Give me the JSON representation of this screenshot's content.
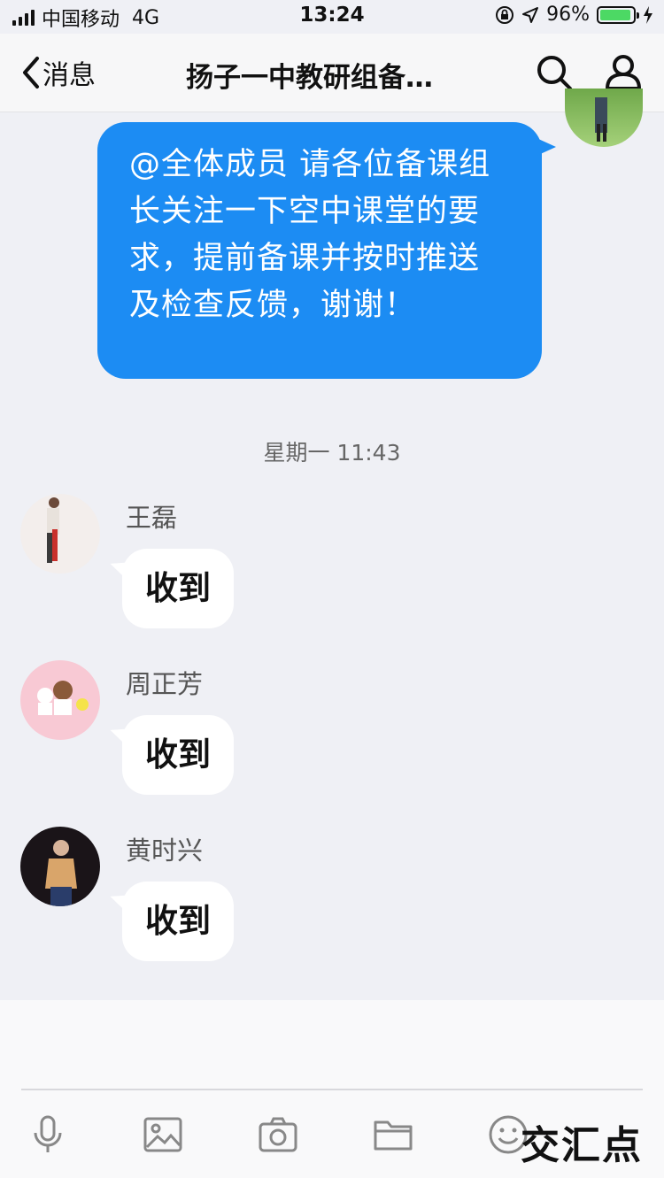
{
  "status": {
    "carrier": "中国移动",
    "network": "4G",
    "time": "13:24",
    "battery": "96%",
    "battery_level": 0.96
  },
  "nav": {
    "back_label": "消息",
    "title": "扬子一中教研组备…"
  },
  "outgoing_message": {
    "text": "@全体成员 请各位备课组长关注一下空中课堂的要求，提前备课并按时推送及检查反馈，谢谢！"
  },
  "timestamp": "星期一 11:43",
  "messages": [
    {
      "sender": "王磊",
      "text": "收到"
    },
    {
      "sender": "周正芳",
      "text": "收到"
    },
    {
      "sender": "黄时兴",
      "text": "收到"
    }
  ],
  "toolbar": {
    "icons": [
      "microphone-icon",
      "image-icon",
      "camera-icon",
      "folder-icon",
      "emoji-icon"
    ]
  },
  "watermark": "交汇点"
}
